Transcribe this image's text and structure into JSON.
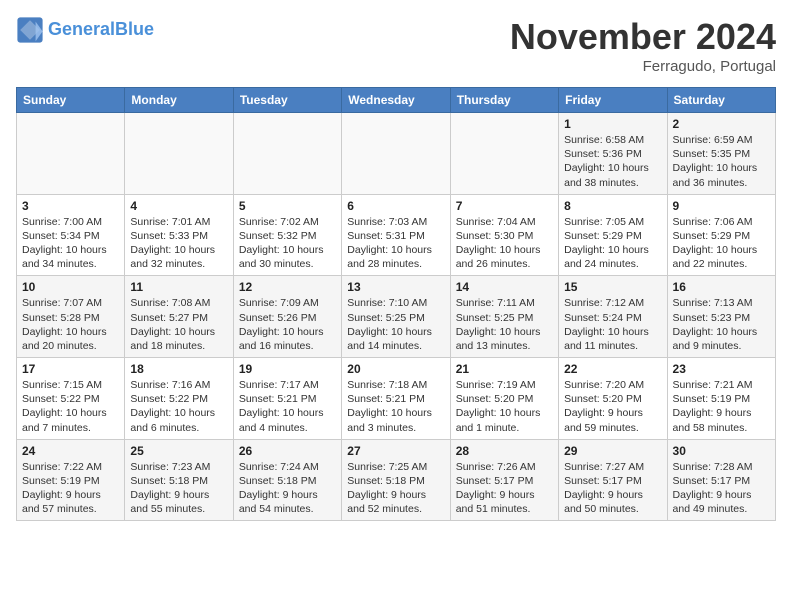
{
  "header": {
    "logo_line1": "General",
    "logo_line2": "Blue",
    "month": "November 2024",
    "location": "Ferragudo, Portugal"
  },
  "weekdays": [
    "Sunday",
    "Monday",
    "Tuesday",
    "Wednesday",
    "Thursday",
    "Friday",
    "Saturday"
  ],
  "weeks": [
    [
      {
        "day": "",
        "info": ""
      },
      {
        "day": "",
        "info": ""
      },
      {
        "day": "",
        "info": ""
      },
      {
        "day": "",
        "info": ""
      },
      {
        "day": "",
        "info": ""
      },
      {
        "day": "1",
        "info": "Sunrise: 6:58 AM\nSunset: 5:36 PM\nDaylight: 10 hours\nand 38 minutes."
      },
      {
        "day": "2",
        "info": "Sunrise: 6:59 AM\nSunset: 5:35 PM\nDaylight: 10 hours\nand 36 minutes."
      }
    ],
    [
      {
        "day": "3",
        "info": "Sunrise: 7:00 AM\nSunset: 5:34 PM\nDaylight: 10 hours\nand 34 minutes."
      },
      {
        "day": "4",
        "info": "Sunrise: 7:01 AM\nSunset: 5:33 PM\nDaylight: 10 hours\nand 32 minutes."
      },
      {
        "day": "5",
        "info": "Sunrise: 7:02 AM\nSunset: 5:32 PM\nDaylight: 10 hours\nand 30 minutes."
      },
      {
        "day": "6",
        "info": "Sunrise: 7:03 AM\nSunset: 5:31 PM\nDaylight: 10 hours\nand 28 minutes."
      },
      {
        "day": "7",
        "info": "Sunrise: 7:04 AM\nSunset: 5:30 PM\nDaylight: 10 hours\nand 26 minutes."
      },
      {
        "day": "8",
        "info": "Sunrise: 7:05 AM\nSunset: 5:29 PM\nDaylight: 10 hours\nand 24 minutes."
      },
      {
        "day": "9",
        "info": "Sunrise: 7:06 AM\nSunset: 5:29 PM\nDaylight: 10 hours\nand 22 minutes."
      }
    ],
    [
      {
        "day": "10",
        "info": "Sunrise: 7:07 AM\nSunset: 5:28 PM\nDaylight: 10 hours\nand 20 minutes."
      },
      {
        "day": "11",
        "info": "Sunrise: 7:08 AM\nSunset: 5:27 PM\nDaylight: 10 hours\nand 18 minutes."
      },
      {
        "day": "12",
        "info": "Sunrise: 7:09 AM\nSunset: 5:26 PM\nDaylight: 10 hours\nand 16 minutes."
      },
      {
        "day": "13",
        "info": "Sunrise: 7:10 AM\nSunset: 5:25 PM\nDaylight: 10 hours\nand 14 minutes."
      },
      {
        "day": "14",
        "info": "Sunrise: 7:11 AM\nSunset: 5:25 PM\nDaylight: 10 hours\nand 13 minutes."
      },
      {
        "day": "15",
        "info": "Sunrise: 7:12 AM\nSunset: 5:24 PM\nDaylight: 10 hours\nand 11 minutes."
      },
      {
        "day": "16",
        "info": "Sunrise: 7:13 AM\nSunset: 5:23 PM\nDaylight: 10 hours\nand 9 minutes."
      }
    ],
    [
      {
        "day": "17",
        "info": "Sunrise: 7:15 AM\nSunset: 5:22 PM\nDaylight: 10 hours\nand 7 minutes."
      },
      {
        "day": "18",
        "info": "Sunrise: 7:16 AM\nSunset: 5:22 PM\nDaylight: 10 hours\nand 6 minutes."
      },
      {
        "day": "19",
        "info": "Sunrise: 7:17 AM\nSunset: 5:21 PM\nDaylight: 10 hours\nand 4 minutes."
      },
      {
        "day": "20",
        "info": "Sunrise: 7:18 AM\nSunset: 5:21 PM\nDaylight: 10 hours\nand 3 minutes."
      },
      {
        "day": "21",
        "info": "Sunrise: 7:19 AM\nSunset: 5:20 PM\nDaylight: 10 hours\nand 1 minute."
      },
      {
        "day": "22",
        "info": "Sunrise: 7:20 AM\nSunset: 5:20 PM\nDaylight: 9 hours\nand 59 minutes."
      },
      {
        "day": "23",
        "info": "Sunrise: 7:21 AM\nSunset: 5:19 PM\nDaylight: 9 hours\nand 58 minutes."
      }
    ],
    [
      {
        "day": "24",
        "info": "Sunrise: 7:22 AM\nSunset: 5:19 PM\nDaylight: 9 hours\nand 57 minutes."
      },
      {
        "day": "25",
        "info": "Sunrise: 7:23 AM\nSunset: 5:18 PM\nDaylight: 9 hours\nand 55 minutes."
      },
      {
        "day": "26",
        "info": "Sunrise: 7:24 AM\nSunset: 5:18 PM\nDaylight: 9 hours\nand 54 minutes."
      },
      {
        "day": "27",
        "info": "Sunrise: 7:25 AM\nSunset: 5:18 PM\nDaylight: 9 hours\nand 52 minutes."
      },
      {
        "day": "28",
        "info": "Sunrise: 7:26 AM\nSunset: 5:17 PM\nDaylight: 9 hours\nand 51 minutes."
      },
      {
        "day": "29",
        "info": "Sunrise: 7:27 AM\nSunset: 5:17 PM\nDaylight: 9 hours\nand 50 minutes."
      },
      {
        "day": "30",
        "info": "Sunrise: 7:28 AM\nSunset: 5:17 PM\nDaylight: 9 hours\nand 49 minutes."
      }
    ]
  ]
}
